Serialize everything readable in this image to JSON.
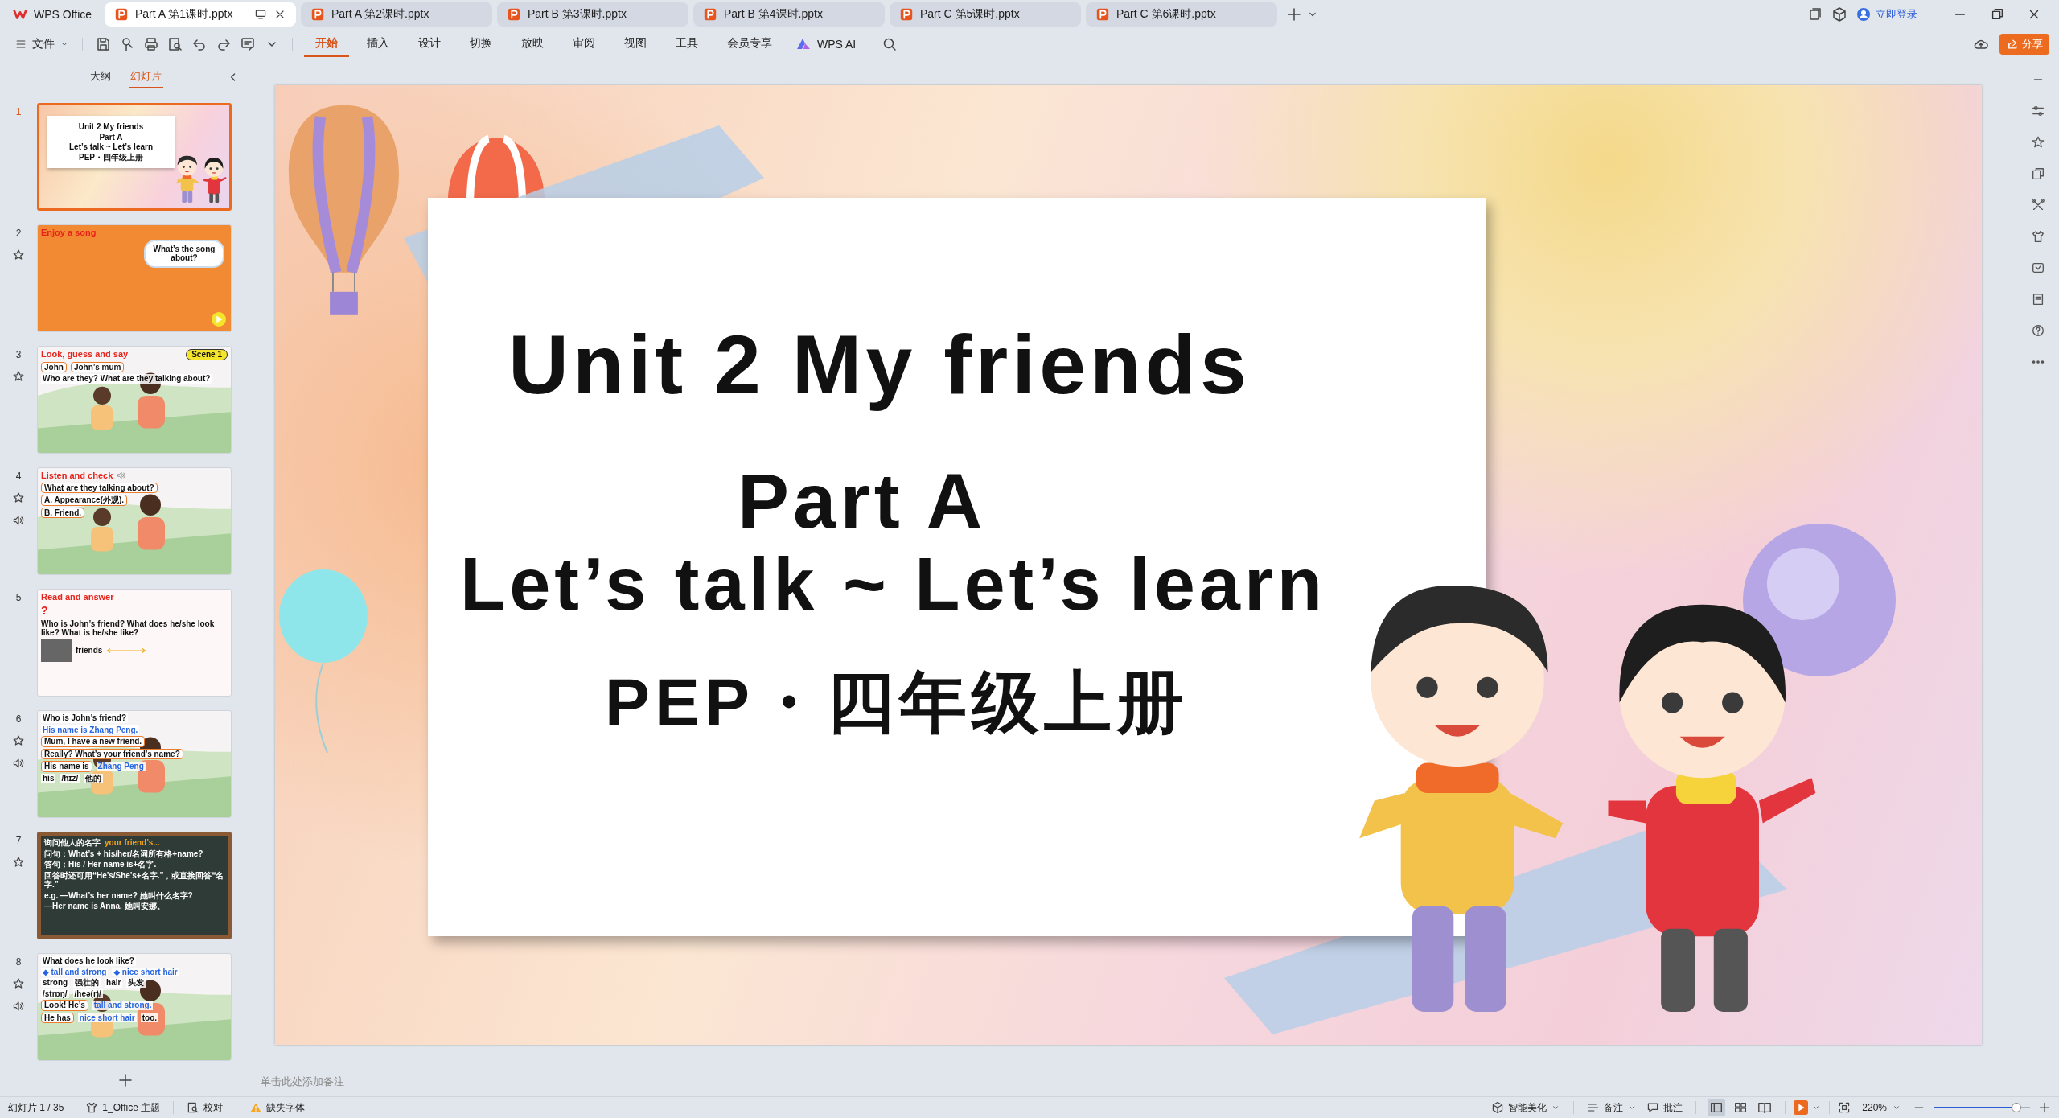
{
  "tabs": [
    {
      "label": "WPS Office",
      "kind": "home",
      "selected": false
    },
    {
      "label": "Part A 第1课时.pptx",
      "kind": "file",
      "selected": true
    },
    {
      "label": "Part A 第2课时.pptx",
      "kind": "file",
      "selected": false
    },
    {
      "label": "Part B 第3课时.pptx",
      "kind": "file",
      "selected": false
    },
    {
      "label": "Part B 第4课时.pptx",
      "kind": "file",
      "selected": false
    },
    {
      "label": "Part C 第5课时.pptx",
      "kind": "file",
      "selected": false
    },
    {
      "label": "Part C 第6课时.pptx",
      "kind": "file",
      "selected": false
    }
  ],
  "account": {
    "login": "立即登录"
  },
  "toolbar": {
    "file_menu": "文件",
    "menus": [
      {
        "label": "开始",
        "selected": true
      },
      {
        "label": "插入",
        "selected": false
      },
      {
        "label": "设计",
        "selected": false
      },
      {
        "label": "切换",
        "selected": false
      },
      {
        "label": "放映",
        "selected": false
      },
      {
        "label": "审阅",
        "selected": false
      },
      {
        "label": "视图",
        "selected": false
      },
      {
        "label": "工具",
        "selected": false
      },
      {
        "label": "会员专享",
        "selected": false
      }
    ],
    "ai": "WPS AI",
    "share": "分享"
  },
  "panel": {
    "tabs": [
      {
        "label": "大纲",
        "selected": false
      },
      {
        "label": "幻灯片",
        "selected": true
      }
    ]
  },
  "thumbnails": [
    {
      "number": "1",
      "selected": true,
      "star": false,
      "audio": false,
      "kind": "cover",
      "lines": [
        {
          "items": [
            {
              "text": "Unit 2 My friends",
              "kind": "heading"
            }
          ]
        },
        {
          "items": [
            {
              "text": "Part A",
              "kind": "heading"
            }
          ]
        },
        {
          "items": [
            {
              "text": "Let’s talk ~ Let’s learn",
              "kind": "heading"
            }
          ]
        },
        {
          "items": [
            {
              "text": "PEP・四年级上册",
              "kind": "heading"
            }
          ]
        }
      ]
    },
    {
      "number": "2",
      "selected": false,
      "star": true,
      "audio": false,
      "kind": "orange",
      "lines": [
        {
          "items": [
            {
              "text": "Enjoy a song",
              "kind": "title"
            }
          ]
        },
        {
          "items": [
            {
              "text": "What’s the song about?",
              "kind": "cloud"
            }
          ]
        }
      ]
    },
    {
      "number": "3",
      "selected": false,
      "star": true,
      "audio": false,
      "kind": "scene",
      "lines": [
        {
          "items": [
            {
              "text": "Look, guess and say",
              "kind": "title"
            },
            {
              "text": "Scene 1",
              "kind": "badge"
            }
          ]
        },
        {
          "items": [
            {
              "text": "John",
              "kind": "label"
            },
            {
              "text": "John’s mum",
              "kind": "label"
            }
          ]
        },
        {
          "items": [
            {
              "text": "Who are they? What are they talking about?",
              "kind": "text"
            }
          ]
        }
      ]
    },
    {
      "number": "4",
      "selected": false,
      "star": true,
      "audio": true,
      "kind": "scene",
      "lines": [
        {
          "items": [
            {
              "text": "Listen and check",
              "kind": "title"
            },
            {
              "kind": "speaker"
            }
          ]
        },
        {
          "items": [
            {
              "text": "What are they talking about?",
              "kind": "label"
            }
          ]
        },
        {
          "items": [
            {
              "text": "A. Appearance(外观).",
              "kind": "label"
            }
          ]
        },
        {
          "items": [
            {
              "text": "B. Friend.",
              "kind": "label"
            }
          ]
        }
      ]
    },
    {
      "number": "5",
      "selected": false,
      "star": false,
      "audio": false,
      "kind": "plain",
      "lines": [
        {
          "items": [
            {
              "text": "Read and answer",
              "kind": "title"
            }
          ]
        },
        {
          "items": [
            {
              "text": "?",
              "kind": "mark"
            },
            {
              "text": "Who is John’s friend? What does he/she look like? What is he/she like?",
              "kind": "text"
            }
          ]
        },
        {
          "items": [
            {
              "kind": "silhouette"
            },
            {
              "text": "friends",
              "kind": "text"
            },
            {
              "kind": "arrow"
            }
          ]
        }
      ]
    },
    {
      "number": "6",
      "selected": false,
      "star": true,
      "audio": true,
      "kind": "scene",
      "lines": [
        {
          "items": [
            {
              "text": "Who is John’s friend?",
              "kind": "text"
            },
            {
              "text": "His name is Zhang Peng.",
              "kind": "accent"
            }
          ]
        },
        {
          "items": [
            {
              "text": "Mum, I have a new friend.",
              "kind": "label"
            }
          ]
        },
        {
          "items": [
            {
              "text": "Really? What’s your friend’s name?",
              "kind": "label"
            }
          ]
        },
        {
          "items": [
            {
              "text": "His name is",
              "kind": "label"
            },
            {
              "text": "Zhang Peng",
              "kind": "accent"
            }
          ]
        },
        {
          "items": [
            {
              "text": "his",
              "kind": "text"
            },
            {
              "text": "/hɪz/",
              "kind": "text"
            },
            {
              "text": "他的",
              "kind": "text"
            }
          ]
        }
      ]
    },
    {
      "number": "7",
      "selected": false,
      "star": true,
      "audio": false,
      "kind": "board",
      "lines": [
        {
          "items": [
            {
              "text": "询问他人的名字",
              "kind": "board"
            },
            {
              "text": "your friend’s...",
              "kind": "gold"
            }
          ]
        },
        {
          "items": [
            {
              "text": "问句：What’s + his/her/名词所有格+name?",
              "kind": "board"
            }
          ]
        },
        {
          "items": [
            {
              "text": "答句：His / Her name is+名字.",
              "kind": "board"
            }
          ]
        },
        {
          "items": [
            {
              "text": "回答时还可用“He’s/She’s+名字.”，或直接回答“名字.”",
              "kind": "board"
            }
          ]
        },
        {
          "items": [
            {
              "text": "e.g. —What’s her name? 她叫什么名字?",
              "kind": "board"
            }
          ]
        },
        {
          "items": [
            {
              "text": "—Her name is Anna. 她叫安娜。",
              "kind": "board"
            }
          ]
        }
      ]
    },
    {
      "number": "8",
      "selected": false,
      "star": true,
      "audio": true,
      "kind": "scene",
      "lines": [
        {
          "items": [
            {
              "text": "What does he look like?",
              "kind": "text"
            }
          ]
        },
        {
          "items": [
            {
              "text": "◆ tall and strong",
              "kind": "accent"
            },
            {
              "text": "◆ nice short hair",
              "kind": "accent"
            }
          ]
        },
        {
          "items": [
            {
              "text": "strong",
              "kind": "text"
            },
            {
              "text": "强壮的",
              "kind": "text"
            },
            {
              "text": "hair",
              "kind": "text"
            },
            {
              "text": "头发",
              "kind": "text"
            }
          ]
        },
        {
          "items": [
            {
              "text": "/strɒŋ/",
              "kind": "text"
            },
            {
              "text": "/heə(r)/",
              "kind": "text"
            }
          ]
        },
        {
          "items": [
            {
              "text": "Look! He’s",
              "kind": "label"
            },
            {
              "text": "tall and strong.",
              "kind": "accent"
            }
          ]
        },
        {
          "items": [
            {
              "text": "He has",
              "kind": "label"
            },
            {
              "text": "nice short hair",
              "kind": "accent"
            },
            {
              "text": "too.",
              "kind": "text"
            }
          ]
        }
      ]
    }
  ],
  "slide": {
    "title": "Unit 2 My friends",
    "part": "Part A",
    "subtitle": "Let’s talk ~ Let’s learn",
    "grade": "PEP・四年级上册"
  },
  "notes": {
    "placeholder": "单击此处添加备注"
  },
  "status_bar": {
    "slide_counter": "幻灯片 1 / 35",
    "theme": "1_Office 主题",
    "proofing": "校对",
    "missing_fonts": "缺失字体",
    "beautify": "智能美化",
    "notes": "备注",
    "comments": "批注",
    "views": [
      {
        "kind": "normal",
        "selected": true
      },
      {
        "kind": "sorter",
        "selected": false
      },
      {
        "kind": "reading",
        "selected": false
      }
    ],
    "zoom": "220%",
    "zoom_level": {
      "level": 0.86
    }
  }
}
